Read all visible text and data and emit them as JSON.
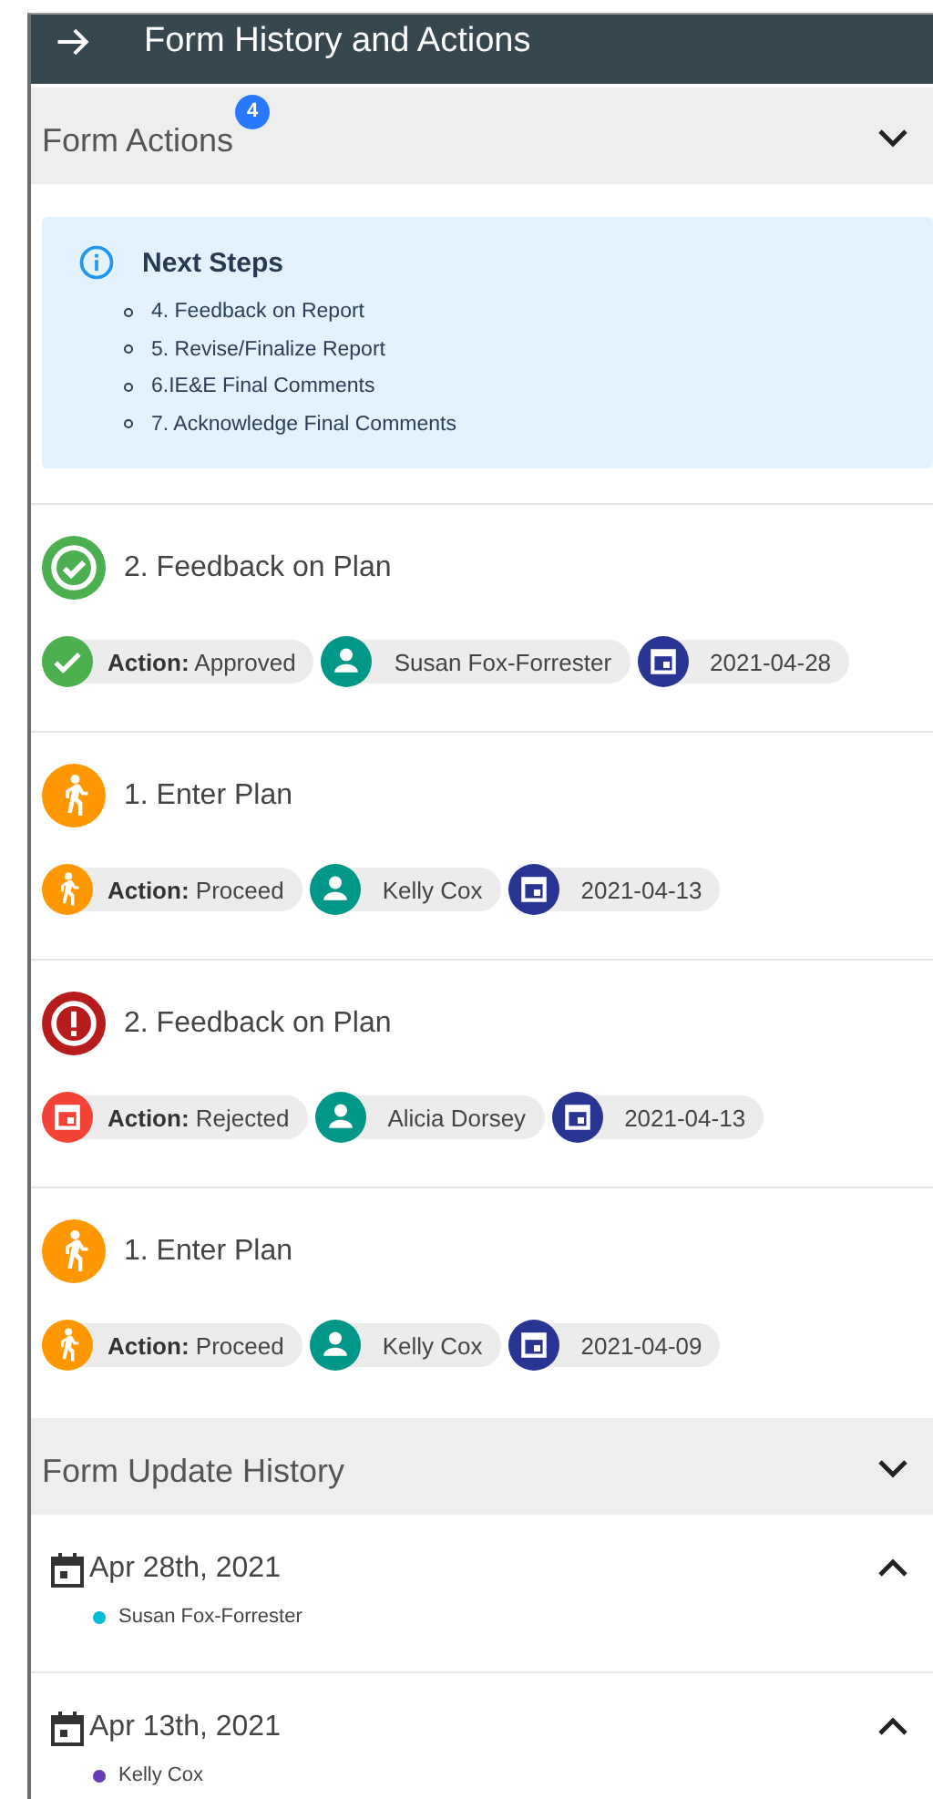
{
  "window": {
    "title": "Form History and Actions"
  },
  "form_actions": {
    "title": "Form Actions",
    "badge": "4",
    "next_steps": {
      "title": "Next Steps",
      "items": [
        "4. Feedback on Report",
        "5. Revise/Finalize Report",
        "6.IE&E Final Comments",
        "7. Acknowledge Final Comments"
      ]
    },
    "actions": [
      {
        "kind": "approved",
        "step": "2. Feedback on Plan",
        "action": "**Action:** Approved",
        "user": "Susan Fox-Forrester",
        "date": "2021-04-28"
      },
      {
        "kind": "proceed",
        "step": "1. Enter Plan",
        "action": "**Action:** Proceed",
        "user": "Kelly Cox",
        "date": "2021-04-13"
      },
      {
        "kind": "rejected",
        "step": "2. Feedback on Plan",
        "action": "**Action:** Rejected",
        "user": "Alicia Dorsey",
        "date": "2021-04-13"
      },
      {
        "kind": "proceed",
        "step": "1. Enter Plan",
        "action": "**Action:** Proceed",
        "user": "Kelly Cox",
        "date": "2021-04-09"
      }
    ]
  },
  "update_history": {
    "title": "Form Update History",
    "entries": [
      {
        "date": "Apr 28th, 2021",
        "expanded": true,
        "users": [
          {
            "name": "Susan Fox-Forrester",
            "color": "#00bcd4"
          }
        ]
      },
      {
        "date": "Apr 13th, 2021",
        "expanded": true,
        "users": [
          {
            "name": "Kelly Cox",
            "color": "#673ab7"
          }
        ]
      }
    ]
  }
}
